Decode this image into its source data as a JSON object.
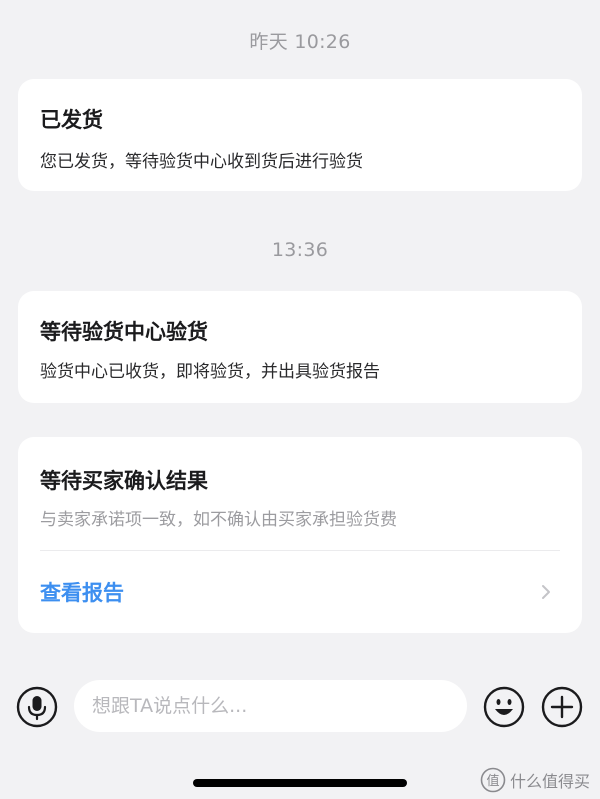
{
  "messages": [
    {
      "timestamp": "昨天 10:26",
      "title": "已发货",
      "description": "您已发货，等待验货中心收到货后进行验货"
    },
    {
      "timestamp": "13:36",
      "title": "等待验货中心验货",
      "description": "验货中心已收货，即将验货，并出具验货报告"
    },
    {
      "title": "等待买家确认结果",
      "description": "与卖家承诺项一致，如不确认由买家承担验货费",
      "link_label": "查看报告"
    }
  ],
  "composer": {
    "placeholder": "想跟TA说点什么..."
  },
  "watermark": {
    "text": "什么值得买"
  },
  "colors": {
    "background": "#f2f2f4",
    "card": "#ffffff",
    "link": "#3d8ff0",
    "muted": "#9c9ca0"
  },
  "icons": [
    "microphone-icon",
    "chevron-right-icon",
    "emoji-icon",
    "plus-icon",
    "watermark-logo-icon"
  ]
}
